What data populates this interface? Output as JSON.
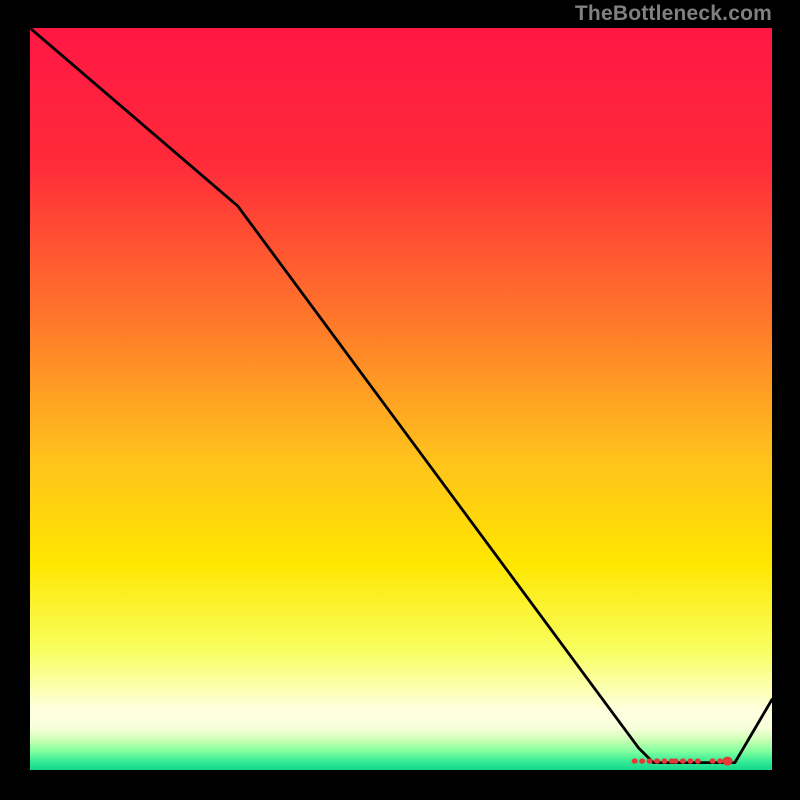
{
  "watermark": "TheBottleneck.com",
  "chart_data": {
    "type": "line",
    "title": "",
    "xlabel": "",
    "ylabel": "",
    "xlim": [
      0,
      1
    ],
    "ylim": [
      0,
      1
    ],
    "series": [
      {
        "name": "curve",
        "x": [
          0.0,
          0.28,
          0.82,
          0.84,
          0.86,
          0.88,
          0.89,
          0.91,
          0.93,
          0.95,
          1.0
        ],
        "values": [
          1.0,
          0.76,
          0.03,
          0.01,
          0.01,
          0.01,
          0.01,
          0.01,
          0.01,
          0.01,
          0.095
        ]
      }
    ],
    "markers": {
      "name": "red_glyphs",
      "x": [
        0.815,
        0.825,
        0.835,
        0.845,
        0.855,
        0.865,
        0.87,
        0.88,
        0.89,
        0.9,
        0.92,
        0.93,
        0.94
      ],
      "y": [
        0.012,
        0.012,
        0.012,
        0.012,
        0.012,
        0.012,
        0.012,
        0.012,
        0.012,
        0.012,
        0.012,
        0.012,
        0.012
      ]
    },
    "gradient_stops": [
      {
        "offset": 0.0,
        "color": "#ff1744"
      },
      {
        "offset": 0.18,
        "color": "#ff2a3a"
      },
      {
        "offset": 0.4,
        "color": "#ff7a2a"
      },
      {
        "offset": 0.58,
        "color": "#ffc21c"
      },
      {
        "offset": 0.72,
        "color": "#ffe600"
      },
      {
        "offset": 0.84,
        "color": "#f8ff60"
      },
      {
        "offset": 0.92,
        "color": "#ffffe0"
      },
      {
        "offset": 0.945,
        "color": "#f5ffd8"
      },
      {
        "offset": 0.96,
        "color": "#c8ffb2"
      },
      {
        "offset": 0.975,
        "color": "#7fffa0"
      },
      {
        "offset": 0.99,
        "color": "#30e895"
      },
      {
        "offset": 1.0,
        "color": "#15d68a"
      }
    ],
    "marker_color": "#e53935"
  }
}
